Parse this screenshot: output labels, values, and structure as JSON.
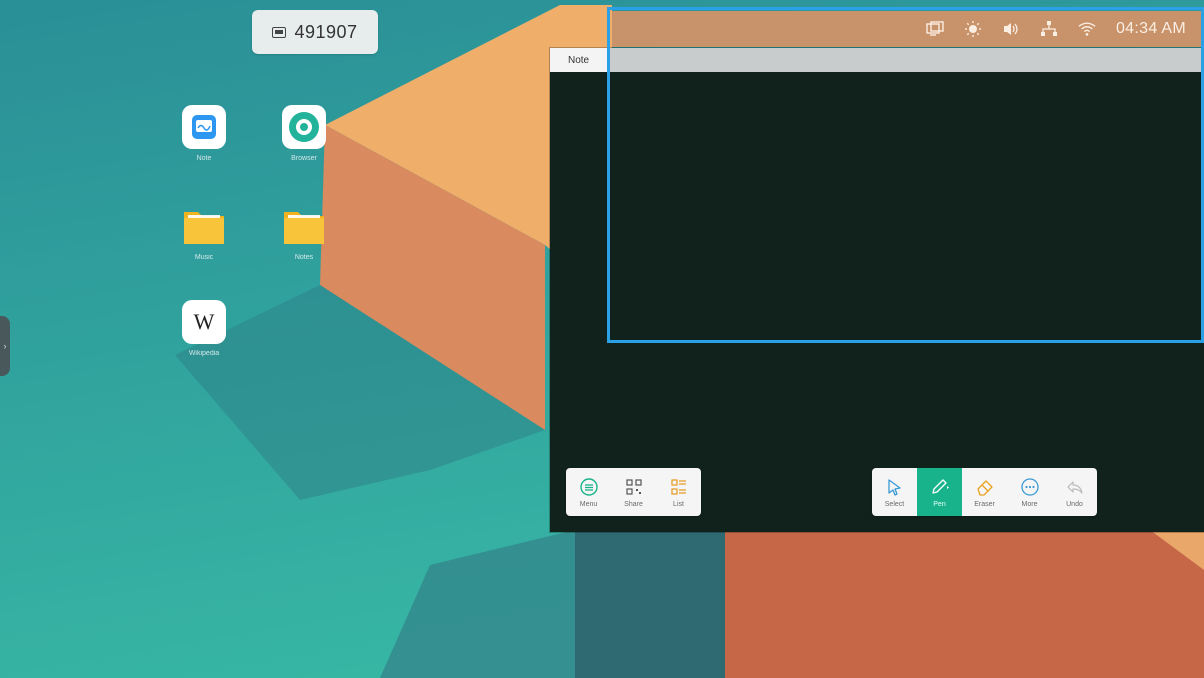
{
  "code_pill": {
    "icon": "screen-icon",
    "code": "491907"
  },
  "desktop": {
    "icons": [
      {
        "label": "Note",
        "icon": "note-app-icon"
      },
      {
        "label": "Browser",
        "icon": "browser-app-icon"
      },
      {
        "label": "Music",
        "icon": "folder-icon"
      },
      {
        "label": "Notes",
        "icon": "folder-icon"
      },
      {
        "label": "Wikipedia",
        "icon": "wikipedia-icon",
        "glyph": "W"
      }
    ]
  },
  "note_window": {
    "tab_label": "Note"
  },
  "status_bar": {
    "icons": [
      "screen-mirror-icon",
      "brightness-icon",
      "volume-icon",
      "network-icon",
      "wifi-icon"
    ],
    "time": "04:34 AM"
  },
  "toolbar_left": {
    "items": [
      {
        "label": "Menu",
        "icon": "menu-icon"
      },
      {
        "label": "Share",
        "icon": "qr-code-icon"
      },
      {
        "label": "List",
        "icon": "list-icon"
      }
    ]
  },
  "toolbar_right": {
    "items": [
      {
        "label": "Select",
        "icon": "cursor-icon"
      },
      {
        "label": "Pen",
        "icon": "pen-icon",
        "active": true
      },
      {
        "label": "Eraser",
        "icon": "eraser-icon"
      },
      {
        "label": "More",
        "icon": "more-icon"
      },
      {
        "label": "Undo",
        "icon": "undo-icon"
      }
    ]
  },
  "colors": {
    "accent_green": "#19b38b",
    "selection_blue": "#2aa0e6",
    "status_bar_bg": "#c8926a",
    "canvas_bg": "#11221c"
  }
}
